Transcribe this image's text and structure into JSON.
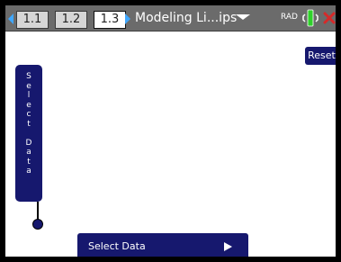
{
  "tabs": [
    {
      "label": "1.1",
      "active": false
    },
    {
      "label": "1.2",
      "active": false
    },
    {
      "label": "1.3",
      "active": true
    }
  ],
  "title": "Modeling Li...ips",
  "status": {
    "angle_mode": "RAD"
  },
  "buttons": {
    "reset": "Reset"
  },
  "select_data_vertical": "Select Data",
  "select_bar": {
    "label": "Select Data"
  },
  "colors": {
    "topbar": "#6b6b6b",
    "accent_blue": "#16186e",
    "nav_arrow": "#3fa7ff",
    "battery_green": "#2fd12a",
    "close_red": "#d62929"
  },
  "icons": [
    "nav-left-arrow-icon",
    "nav-right-arrow-icon",
    "menu-chevron-icon",
    "battery-icon",
    "close-icon",
    "play-arrow-icon"
  ]
}
